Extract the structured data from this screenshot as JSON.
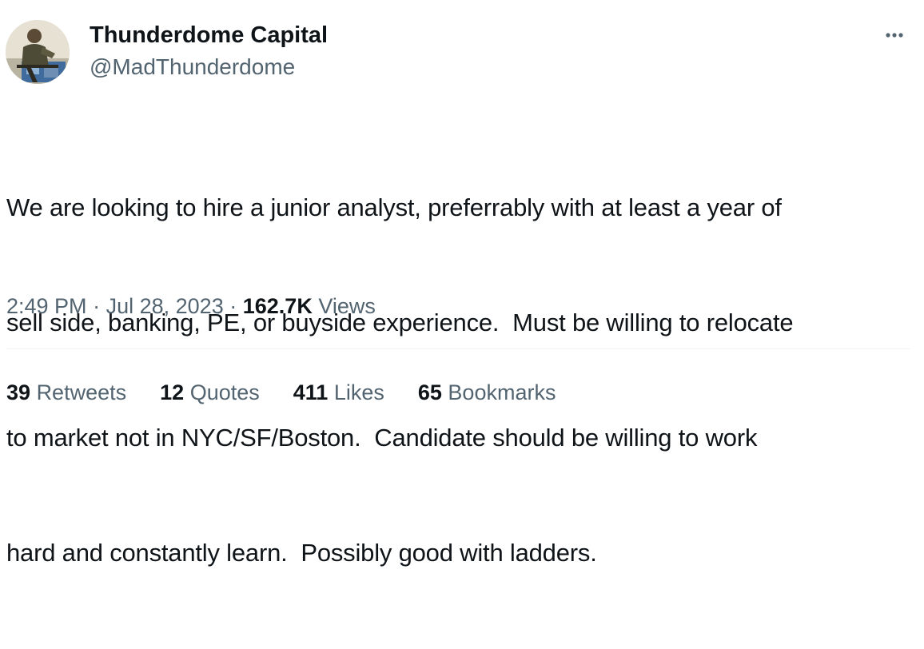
{
  "author": {
    "name": "Thunderdome Capital",
    "handle": "@MadThunderdome"
  },
  "tweet": {
    "lines": [
      "We are looking to hire a junior analyst, preferrably with at least a year of",
      "sell side, banking, PE, or buyside experience.  Must be willing to relocate",
      "to market not in NYC/SF/Boston.  Candidate should be willing to work",
      "hard and constantly learn.  Possibly good with ladders."
    ]
  },
  "meta": {
    "time": "2:49 PM",
    "separator": "·",
    "date": "Jul 28, 2023",
    "views_count": "162.7K",
    "views_label": "Views"
  },
  "stats": [
    {
      "count": "39",
      "label": "Retweets"
    },
    {
      "count": "12",
      "label": "Quotes"
    },
    {
      "count": "411",
      "label": "Likes"
    },
    {
      "count": "65",
      "label": "Bookmarks"
    }
  ],
  "icons": {
    "more": "more-horizontal-icon",
    "avatar": "profile-photo"
  },
  "colors": {
    "primary_text": "#0f1419",
    "secondary_text": "#536471",
    "divider": "#eff3f4",
    "background": "#ffffff"
  }
}
